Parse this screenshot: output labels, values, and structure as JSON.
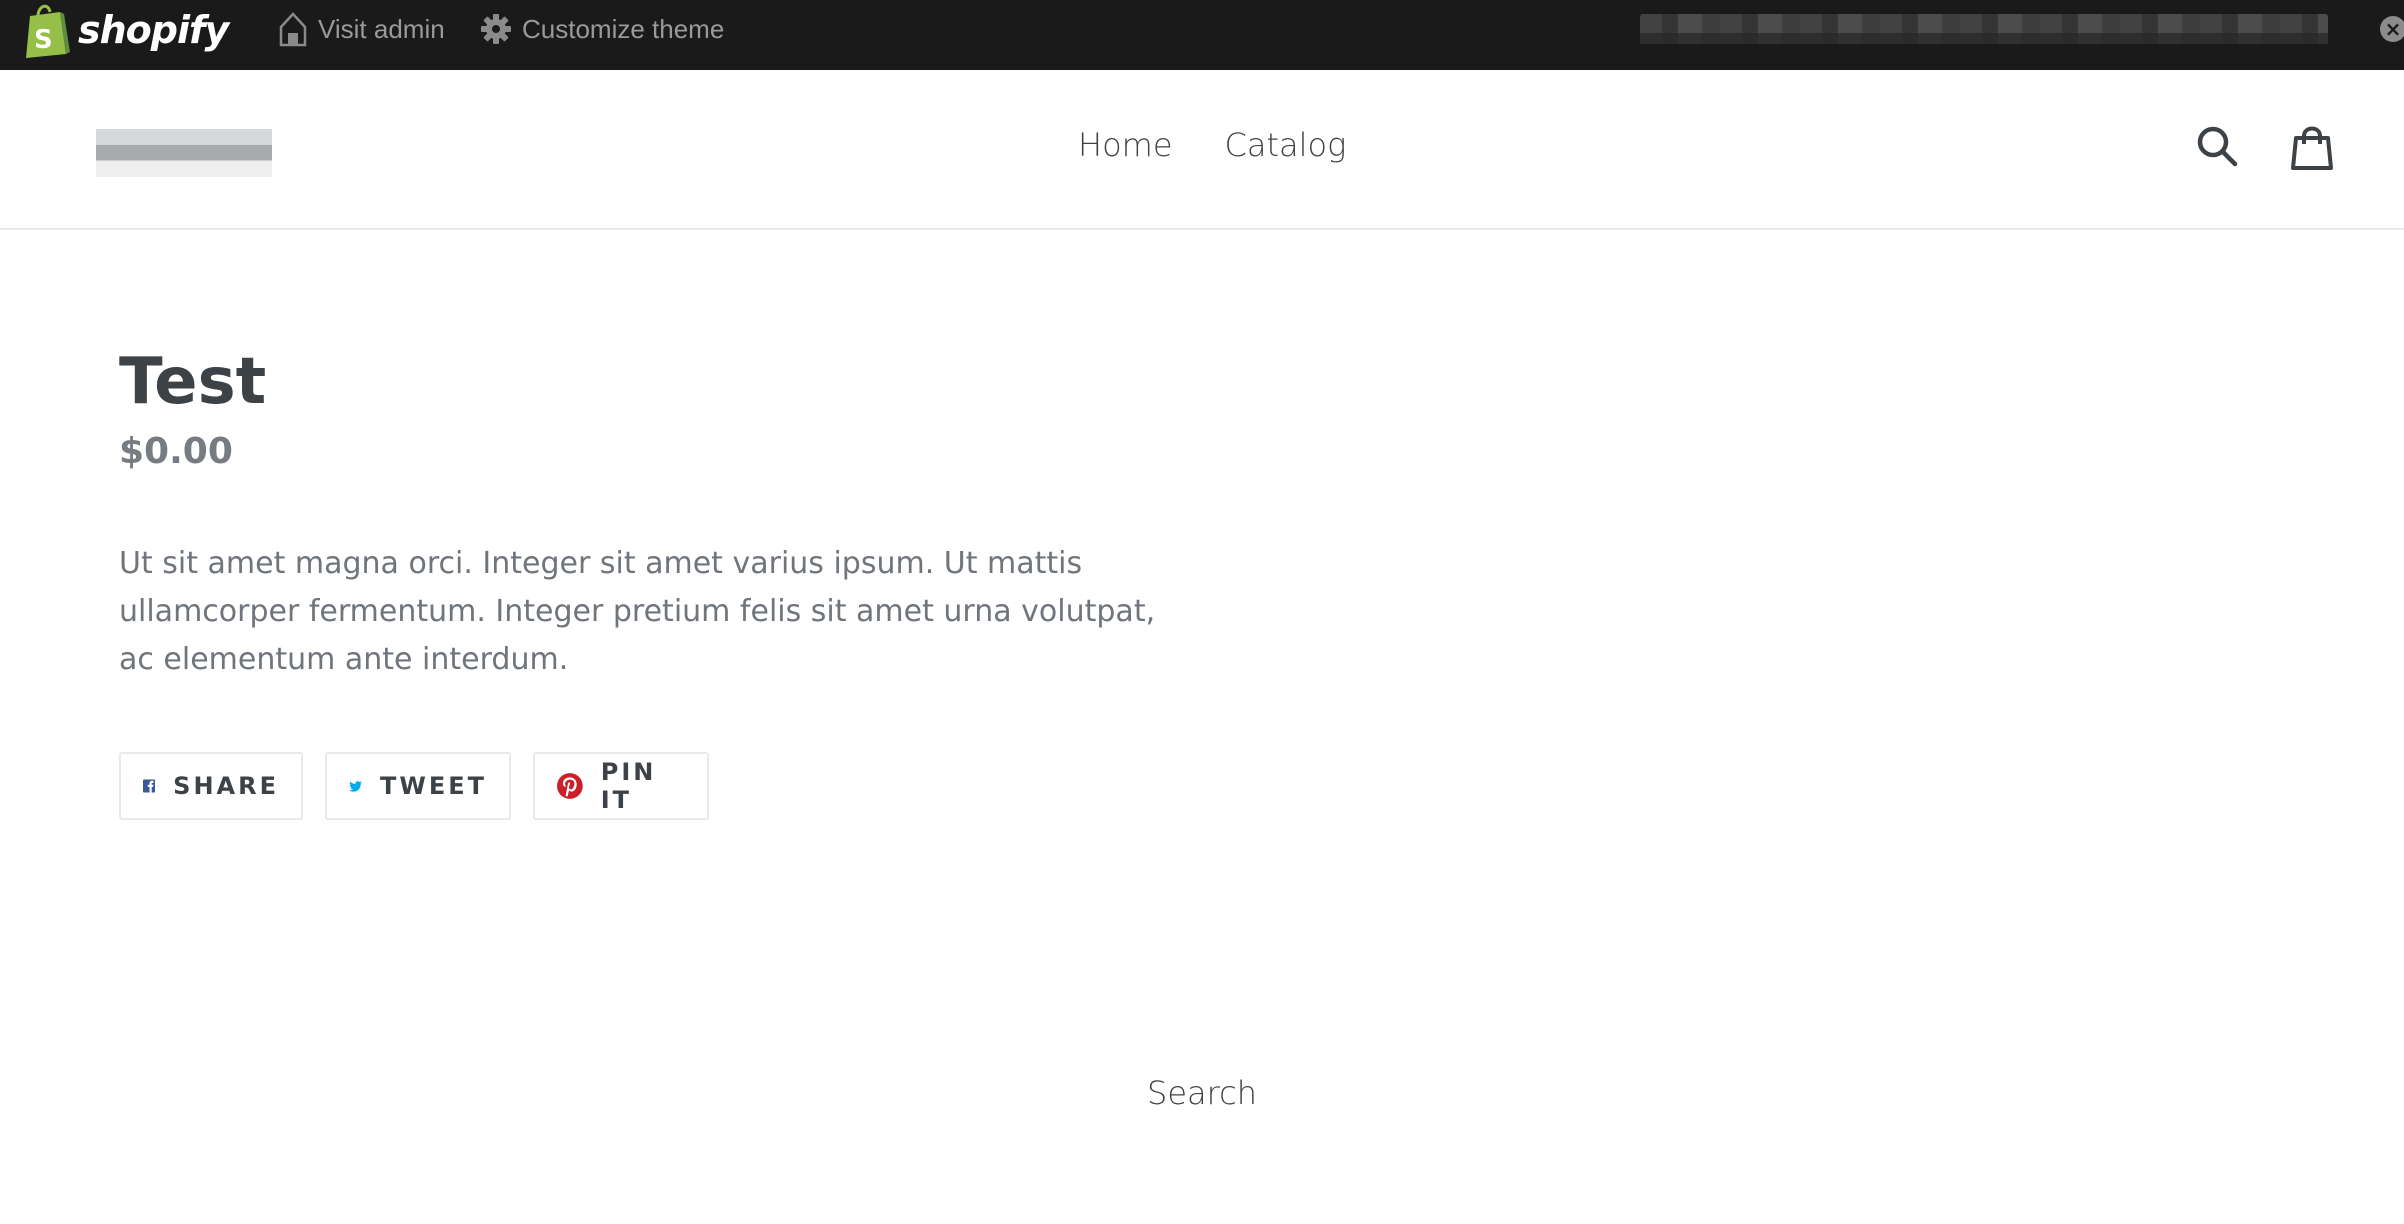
{
  "admin_bar": {
    "brand": "shopify",
    "visit_admin": "Visit admin",
    "customize_theme": "Customize theme",
    "brand_color": "#95bf47",
    "close_symbol": "×"
  },
  "header": {
    "nav": [
      {
        "label": "Home"
      },
      {
        "label": "Catalog"
      }
    ],
    "icons": [
      "search-icon",
      "cart-icon"
    ]
  },
  "product": {
    "title": "Test",
    "price": "$0.00",
    "description": "Ut sit amet magna orci. Integer sit amet varius ipsum. Ut mattis ullamcorper fermentum. Integer pretium felis sit amet urna volutpat, ac elementum ante interdum.",
    "share": [
      {
        "label": "SHARE",
        "icon": "facebook-icon",
        "color": "#3b5998"
      },
      {
        "label": "TWEET",
        "icon": "twitter-icon",
        "color": "#00aced"
      },
      {
        "label": "PIN IT",
        "icon": "pinterest-icon",
        "color": "#cb2027"
      }
    ]
  },
  "footer": {
    "search_link": "Search"
  }
}
